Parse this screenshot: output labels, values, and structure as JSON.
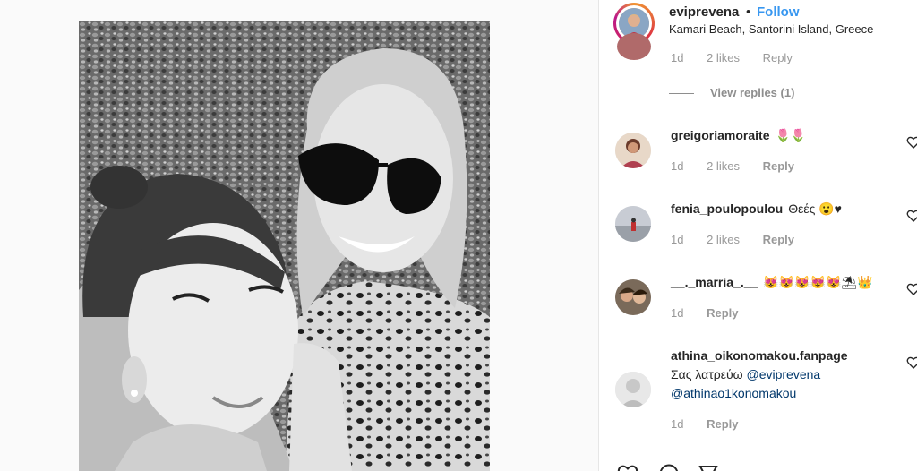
{
  "post": {
    "username": "eviprevena",
    "separator": "•",
    "follow_label": "Follow",
    "location": "Kamari Beach, Santorini Island, Greece"
  },
  "partial_comment": {
    "time": "1d",
    "likes": "2 likes",
    "reply_label": "Reply"
  },
  "view_replies": "View replies (1)",
  "comments": [
    {
      "username": "greigoriamoraite",
      "text": "🌷🌷",
      "time": "1d",
      "likes": "2 likes",
      "reply_label": "Reply"
    },
    {
      "username": "fenia_poulopoulou",
      "text": "Θεές 😮♥",
      "time": "1d",
      "likes": "2 likes",
      "reply_label": "Reply"
    },
    {
      "username": "__._marria_.__",
      "text": "😻😻😻😻😻⛱👑",
      "time": "1d",
      "likes": "",
      "reply_label": "Reply"
    },
    {
      "username": "athina_oikonomakou.fanpage",
      "text": "Σας λατρεύω",
      "mention1": "@eviprevena",
      "mention2": "@athinao1konomakou",
      "time": "1d",
      "likes": "",
      "reply_label": "Reply"
    }
  ],
  "colors": {
    "link": "#3897f0",
    "text": "#262626",
    "muted": "#999999"
  }
}
